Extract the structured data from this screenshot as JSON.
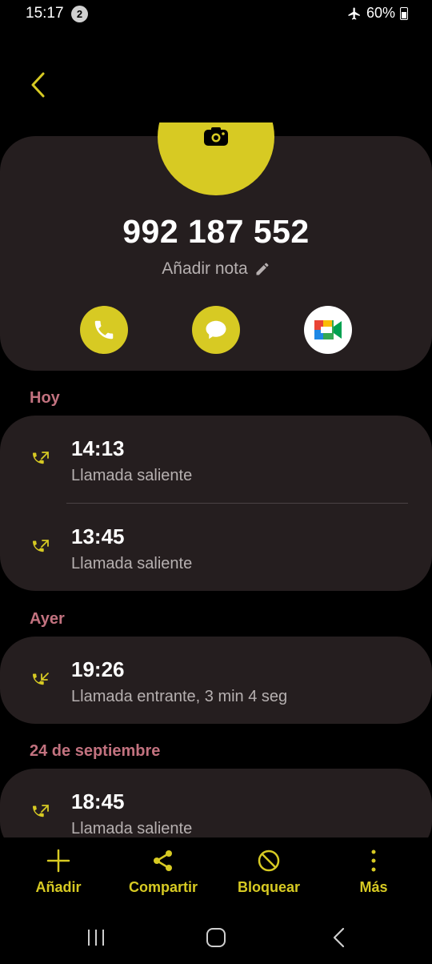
{
  "status_bar": {
    "time": "15:17",
    "notification_count": "2",
    "battery": "60%"
  },
  "contact": {
    "phone_number": "992 187 552",
    "add_note_label": "Añadir nota"
  },
  "colors": {
    "accent": "#d7ca23",
    "section_label": "#c2727f",
    "card_bg": "#251e1f",
    "secondary_text": "#b6b0b0"
  },
  "sections": [
    {
      "label": "Hoy",
      "calls": [
        {
          "time": "14:13",
          "type": "Llamada saliente",
          "direction": "outgoing"
        },
        {
          "time": "13:45",
          "type": "Llamada saliente",
          "direction": "outgoing"
        }
      ]
    },
    {
      "label": "Ayer",
      "calls": [
        {
          "time": "19:26",
          "type": "Llamada entrante, 3 min 4 seg",
          "direction": "incoming"
        }
      ]
    },
    {
      "label": "24 de septiembre",
      "calls": [
        {
          "time": "18:45",
          "type": "Llamada saliente",
          "direction": "outgoing"
        }
      ]
    }
  ],
  "bottom_actions": [
    {
      "label": "Añadir",
      "icon": "plus-icon"
    },
    {
      "label": "Compartir",
      "icon": "share-icon"
    },
    {
      "label": "Bloquear",
      "icon": "block-icon"
    },
    {
      "label": "Más",
      "icon": "more-vertical-icon"
    }
  ]
}
